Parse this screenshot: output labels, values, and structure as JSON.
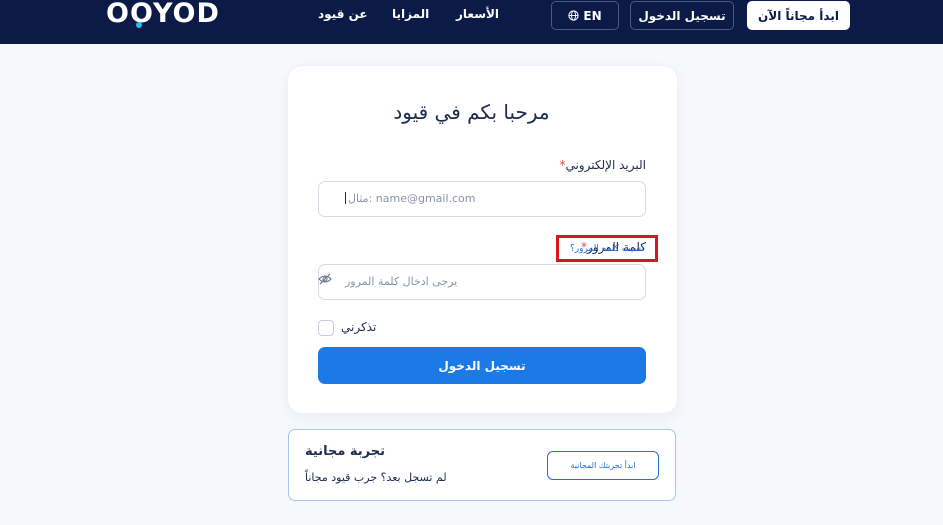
{
  "header": {
    "logo_text": "OOYOD",
    "nav": {
      "about": "عن قيود",
      "features": "المزايا",
      "pricing": "الأسعار"
    },
    "language_label": "EN",
    "login_label": "تسجيل الدخول",
    "start_label": "ابدأ مجاناً الآن"
  },
  "login_card": {
    "title": "مرحبا بكم في قيود",
    "email": {
      "label": "البريد الإلكتروني",
      "placeholder": "مثال: name@gmail.com"
    },
    "password": {
      "label": "كلمة المرور",
      "placeholder": "يرجى ادخال كلمة المرور",
      "forgot_link": "نسيت كلمه المرور؟"
    },
    "remember_label": "تذكرني",
    "submit_label": "تسجيل الدخول"
  },
  "trial_card": {
    "title": "تجربة مجانية",
    "subtitle": "لم تسجل بعد؟ جرب قيود مجاناً",
    "button_label": "ابدأ تجربتك المجانية"
  },
  "colors": {
    "header_bg": "#0b1a47",
    "primary": "#1c7ae6",
    "required": "#e34a4a",
    "highlight": "#d7161f",
    "logo_dot": "#27c4e6"
  },
  "icons": {
    "language": "globe-icon",
    "password_toggle": "eye-slash-icon"
  }
}
